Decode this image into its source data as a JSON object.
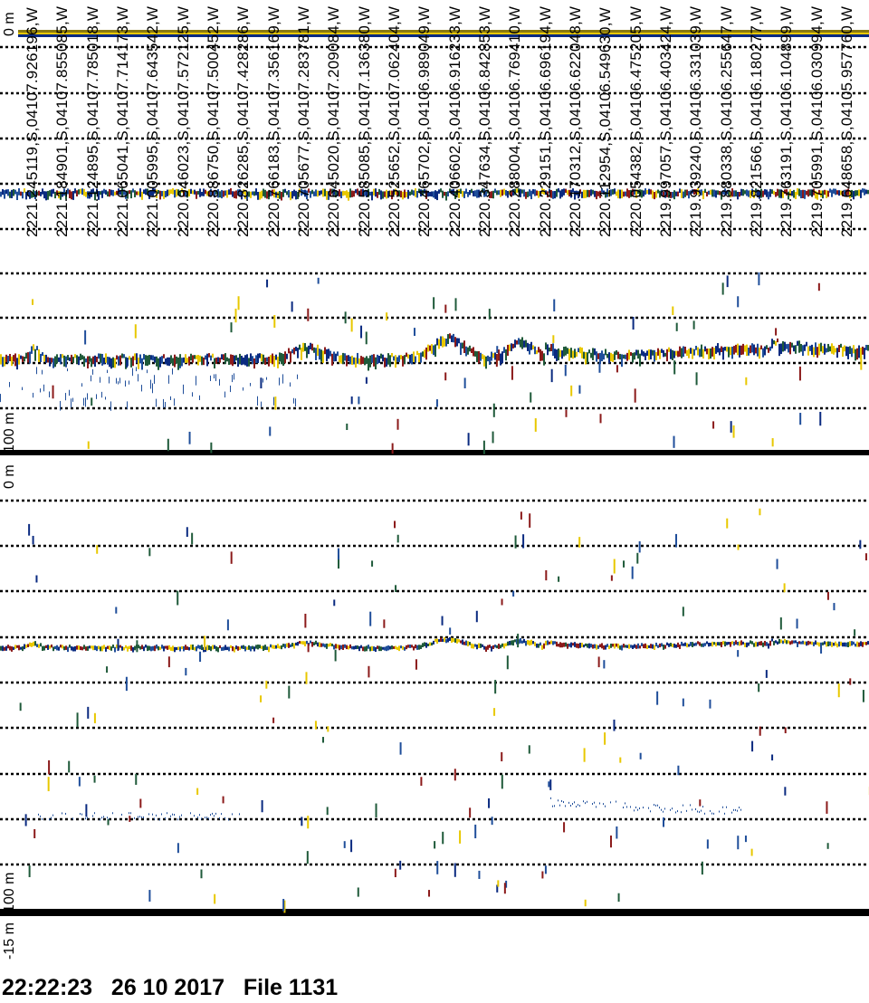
{
  "positions": [
    "2221.245119,S,04107.926196,W",
    "2221.184901,S,04107.855085,W",
    "2221.124895,S,04107.785018,W",
    "2221.065041,S,04107.714173,W",
    "2221.005995,S,04107.643542,W",
    "2220.946023,S,04107.572125,W",
    "2220.886750,S,04107.500452,W",
    "2220.826285,S,04107.428286,W",
    "2220.766183,S,04107.356169,W",
    "2220.705677,S,04107.283781,W",
    "2220.645020,S,04107.209084,W",
    "2220.585085,S,04107.136380,W",
    "2220.525652,S,04107.062404,W",
    "2220.465702,S,04106.989049,W",
    "2220.406602,S,04106.916233,W",
    "2220.347634,S,04106.842853,W",
    "2220.288004,S,04106.769410,W",
    "2220.229151,S,04106.696194,W",
    "2220.170312,S,04106.622048,W",
    "2220.112954,S,04106.549630,W",
    "2220.054382,S,04106.475205,W",
    "2219.997057,S,04106.403424,W",
    "2219.939240,S,04106.331039,W",
    "2219.880338,S,04106.255647,W",
    "2219.821566,S,04106.180277,W",
    "2219.763191,S,04106.104899,W",
    "2219.705991,S,04106.030994,W",
    "2219.648658,S,04105.957760,W"
  ],
  "axis": {
    "top_panel_start": "0 m",
    "top_panel_end": "100 m",
    "bottom_panel_start": "0 m",
    "bottom_panel_end": "100 m",
    "bottom_panel_offset": "-15 m"
  },
  "footer": {
    "time": "22:22:23",
    "date": "26 10 2017",
    "file": "File 1131"
  },
  "colors": {
    "blue": "#1f4e9a",
    "navy": "#0a2a80",
    "red": "#8b1a1a",
    "yellow": "#e8c800",
    "olive": "#8a7a10",
    "green": "#1f5a3a"
  }
}
